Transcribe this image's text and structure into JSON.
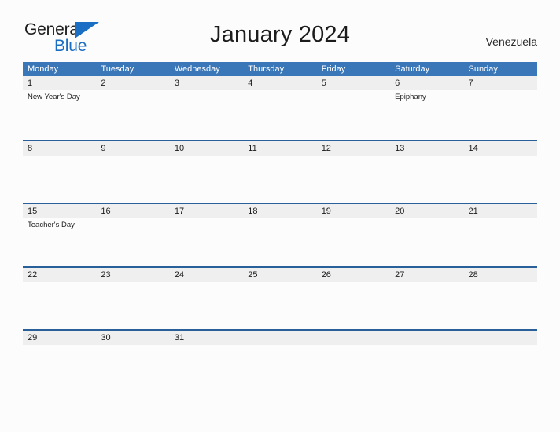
{
  "logo": {
    "word1": "General",
    "word2": "Blue",
    "triangle_color": "#1a6fc4",
    "word1_color": "#1c1c1c",
    "word2_color": "#1a6fc4"
  },
  "header": {
    "title": "January 2024",
    "locale": "Venezuela"
  },
  "theme": {
    "header_band": "#3a77b8",
    "row_divider": "#2a6099",
    "date_band": "#efeff0",
    "page_background": "#fcfcfc",
    "text": "#1c1c1c"
  },
  "calendar": {
    "weekdays": [
      "Monday",
      "Tuesday",
      "Wednesday",
      "Thursday",
      "Friday",
      "Saturday",
      "Sunday"
    ],
    "weeks": [
      {
        "days": [
          {
            "date": "1",
            "events": [
              "New Year's Day"
            ]
          },
          {
            "date": "2",
            "events": []
          },
          {
            "date": "3",
            "events": []
          },
          {
            "date": "4",
            "events": []
          },
          {
            "date": "5",
            "events": []
          },
          {
            "date": "6",
            "events": [
              "Epiphany"
            ]
          },
          {
            "date": "7",
            "events": []
          }
        ]
      },
      {
        "days": [
          {
            "date": "8",
            "events": []
          },
          {
            "date": "9",
            "events": []
          },
          {
            "date": "10",
            "events": []
          },
          {
            "date": "11",
            "events": []
          },
          {
            "date": "12",
            "events": []
          },
          {
            "date": "13",
            "events": []
          },
          {
            "date": "14",
            "events": []
          }
        ]
      },
      {
        "days": [
          {
            "date": "15",
            "events": [
              "Teacher's Day"
            ]
          },
          {
            "date": "16",
            "events": []
          },
          {
            "date": "17",
            "events": []
          },
          {
            "date": "18",
            "events": []
          },
          {
            "date": "19",
            "events": []
          },
          {
            "date": "20",
            "events": []
          },
          {
            "date": "21",
            "events": []
          }
        ]
      },
      {
        "days": [
          {
            "date": "22",
            "events": []
          },
          {
            "date": "23",
            "events": []
          },
          {
            "date": "24",
            "events": []
          },
          {
            "date": "25",
            "events": []
          },
          {
            "date": "26",
            "events": []
          },
          {
            "date": "27",
            "events": []
          },
          {
            "date": "28",
            "events": []
          }
        ]
      },
      {
        "days": [
          {
            "date": "29",
            "events": []
          },
          {
            "date": "30",
            "events": []
          },
          {
            "date": "31",
            "events": []
          },
          {
            "date": "",
            "events": []
          },
          {
            "date": "",
            "events": []
          },
          {
            "date": "",
            "events": []
          },
          {
            "date": "",
            "events": []
          }
        ]
      }
    ]
  }
}
